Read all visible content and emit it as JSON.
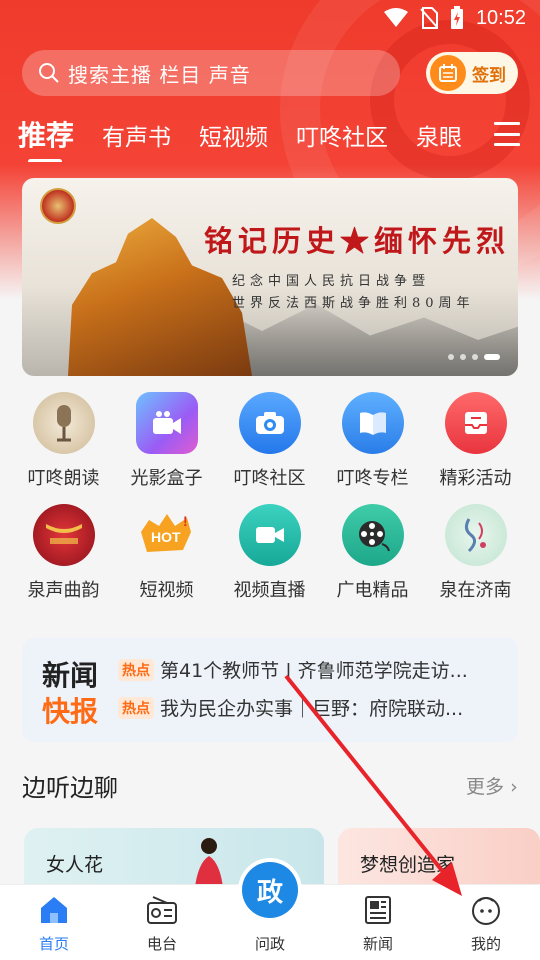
{
  "status_bar": {
    "time": "10:52"
  },
  "search": {
    "placeholder": "搜索主播 栏目 声音"
  },
  "signin": {
    "label": "签到"
  },
  "tabs": [
    {
      "label": "推荐",
      "active": true
    },
    {
      "label": "有声书"
    },
    {
      "label": "短视频"
    },
    {
      "label": "叮咚社区"
    },
    {
      "label": "泉眼"
    }
  ],
  "banner": {
    "title": "铭记历史★缅怀先烈",
    "subtitle_1": "纪念中国人民抗日战争暨",
    "subtitle_2": "世界反法西斯战争胜利80周年"
  },
  "grid": [
    {
      "label": "叮咚朗读",
      "icon": "microphone-icon",
      "color": "#d9c7a7"
    },
    {
      "label": "光影盒子",
      "icon": "video-camera-icon",
      "color": "#8a63f0"
    },
    {
      "label": "叮咚社区",
      "icon": "camera-icon",
      "color": "#2f8cf2"
    },
    {
      "label": "叮咚专栏",
      "icon": "book-icon",
      "color": "#3a8ff0"
    },
    {
      "label": "精彩活动",
      "icon": "inbox-icon",
      "color": "#f0444a"
    },
    {
      "label": "泉声曲韵",
      "icon": "stage-icon",
      "color": "#c0182a"
    },
    {
      "label": "短视频",
      "icon": "hot-badge-icon",
      "color": "#f5a623"
    },
    {
      "label": "视频直播",
      "icon": "live-video-icon",
      "color": "#20b8a8"
    },
    {
      "label": "广电精品",
      "icon": "film-reel-icon",
      "color": "#2ab59a"
    },
    {
      "label": "泉在济南",
      "icon": "spring-icon",
      "color": "#cde9dc"
    }
  ],
  "news": {
    "tag_line1": "新闻",
    "tag_line2": "快报",
    "hot_label": "热点",
    "items": [
      "第41个教师节 | 齐鲁师范学院走访...",
      "我为民企办实事｜巨野：府院联动..."
    ]
  },
  "section": {
    "title": "边听边聊",
    "more": "更多"
  },
  "cards": [
    {
      "title": "女人花"
    },
    {
      "title": "梦想创造家"
    }
  ],
  "bottom_nav": [
    {
      "label": "首页",
      "icon": "home-icon",
      "active": true
    },
    {
      "label": "电台",
      "icon": "radio-icon"
    },
    {
      "label": "问政",
      "icon": "politics-icon",
      "badge": "政"
    },
    {
      "label": "新闻",
      "icon": "newspaper-icon"
    },
    {
      "label": "我的",
      "icon": "profile-icon"
    }
  ],
  "colors": {
    "header_red": "#f44336",
    "accent_blue": "#2a7df4",
    "hot_orange": "#ff6a14",
    "annotation_arrow": "#e8232a"
  }
}
